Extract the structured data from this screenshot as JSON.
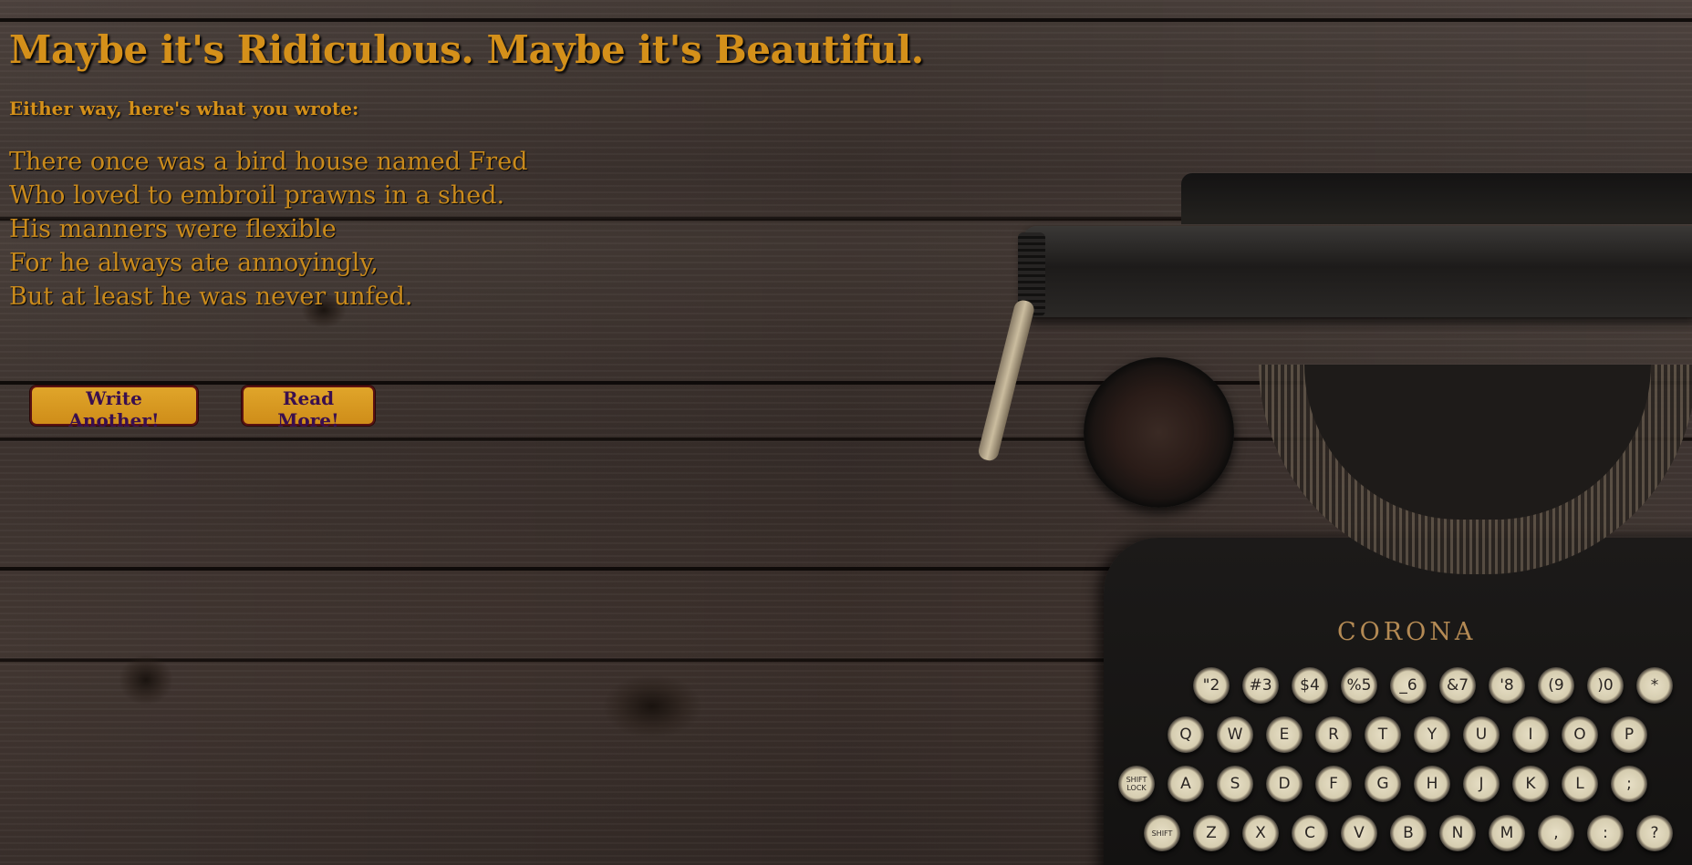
{
  "heading": "Maybe it's Ridiculous. Maybe it's Beautiful.",
  "subheading": "Either way, here's what you wrote:",
  "poem": [
    "There once was a bird house named Fred",
    "Who loved to embroil prawns in a shed.",
    "His manners were flexible",
    "For he always ate annoyingly,",
    "But at least he was never unfed."
  ],
  "buttons": {
    "write_another": "Write Another!",
    "read_more": "Read More!"
  },
  "typewriter": {
    "brand": "CORONA",
    "number_row": [
      "\"2",
      "#3",
      "$4",
      "%5",
      "_6",
      "&7",
      "'8",
      "(9",
      ")0",
      "*"
    ],
    "row_q": [
      "Q",
      "W",
      "E",
      "R",
      "T",
      "Y",
      "U",
      "I",
      "O",
      "P"
    ],
    "row_a": [
      "SHIFT LOCK",
      "A",
      "S",
      "D",
      "F",
      "G",
      "H",
      "J",
      "K",
      "L",
      ";"
    ],
    "row_z": [
      "SHIFT",
      "Z",
      "X",
      "C",
      "V",
      "B",
      "N",
      "M",
      ",",
      ":",
      "?"
    ]
  },
  "colors": {
    "heading_text": "#d4901a",
    "button_bg": "#d4961f",
    "button_text": "#3a0f4e",
    "button_border": "#5a1212",
    "background_wood": "#3d332f"
  }
}
